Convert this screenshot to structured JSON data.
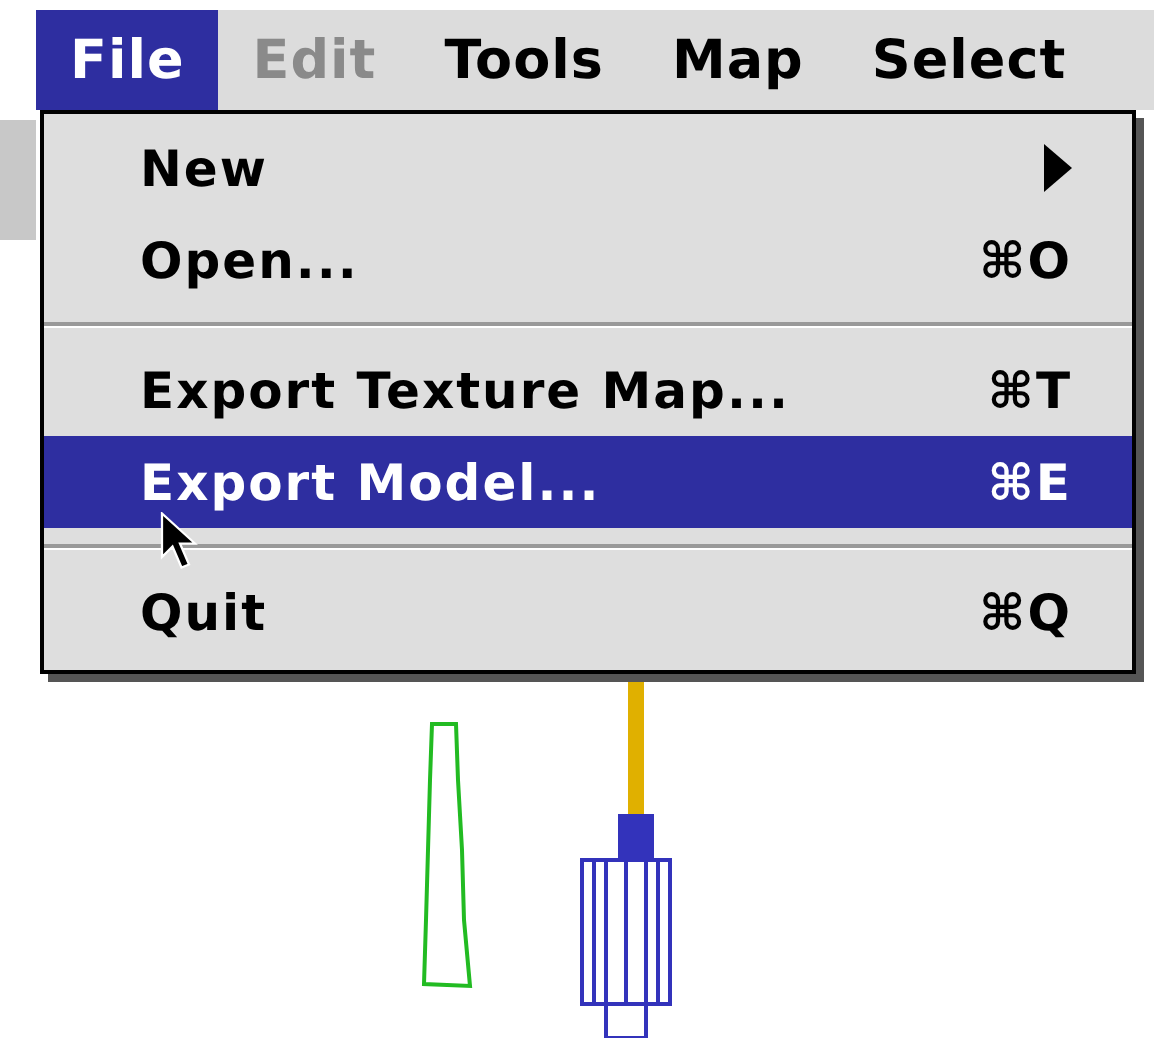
{
  "menu_bar": [
    {
      "label": "File",
      "selected": true,
      "disabled": false
    },
    {
      "label": "Edit",
      "selected": false,
      "disabled": true
    },
    {
      "label": "Tools",
      "selected": false,
      "disabled": false
    },
    {
      "label": "Map",
      "selected": false,
      "disabled": false
    },
    {
      "label": "Select",
      "selected": false,
      "disabled": false
    }
  ],
  "file_menu": [
    {
      "kind": "item",
      "label": "New",
      "submenu": true,
      "selected": false
    },
    {
      "kind": "item",
      "label": "Open...",
      "shortcut": "⌘O",
      "submenu": false,
      "selected": false
    },
    {
      "kind": "separator"
    },
    {
      "kind": "item",
      "label": "Export Texture Map...",
      "shortcut": "⌘T",
      "submenu": false,
      "selected": false
    },
    {
      "kind": "item",
      "label": "Export Model...",
      "shortcut": "⌘E",
      "submenu": false,
      "selected": true
    },
    {
      "kind": "separator"
    },
    {
      "kind": "item",
      "label": "Quit",
      "shortcut": "⌘Q",
      "submenu": false,
      "selected": false
    }
  ]
}
